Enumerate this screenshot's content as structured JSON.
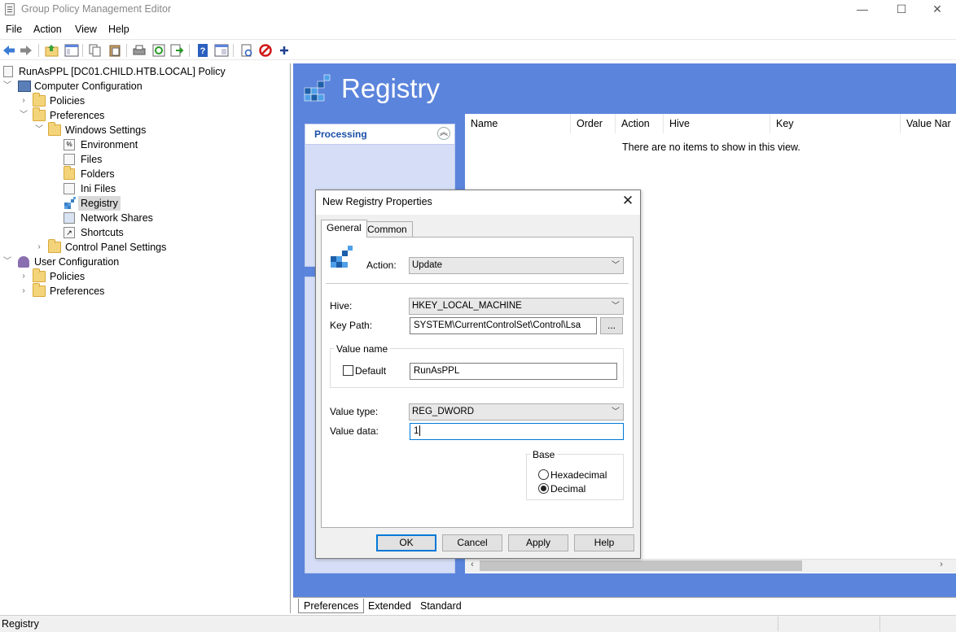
{
  "window": {
    "title": "Group Policy Management Editor",
    "controls": {
      "minimize": "—",
      "maximize": "☐",
      "close": "✕"
    }
  },
  "menu": [
    "File",
    "Action",
    "View",
    "Help"
  ],
  "toolbar": {
    "icons": [
      "back-icon",
      "forward-icon",
      "up-folder-icon",
      "show-hide-tree-icon",
      "copy-icon",
      "paste-icon",
      "print-icon",
      "refresh-icon",
      "export-icon",
      "help-icon",
      "properties-icon",
      "new-item-icon",
      "stop-icon",
      "add-icon"
    ]
  },
  "tree": {
    "root": "RunAsPPL [DC01.CHILD.HTB.LOCAL] Policy",
    "computer_config": "Computer Configuration",
    "policies": "Policies",
    "preferences": "Preferences",
    "windows_settings": "Windows Settings",
    "environment": "Environment",
    "files": "Files",
    "folders": "Folders",
    "ini_files": "Ini Files",
    "registry": "Registry",
    "network_shares": "Network Shares",
    "shortcuts": "Shortcuts",
    "control_panel": "Control Panel Settings",
    "user_config": "User Configuration",
    "user_policies": "Policies",
    "user_preferences": "Preferences"
  },
  "main": {
    "header": "Registry",
    "processing": "Processing",
    "columns": [
      "Name",
      "Order",
      "Action",
      "Hive",
      "Key",
      "Value Nar"
    ],
    "empty_message": "There are no items to show in this view."
  },
  "bottom_tabs": [
    "Preferences",
    "Extended",
    "Standard"
  ],
  "status": {
    "text": "Registry"
  },
  "dialog": {
    "title": "New Registry Properties",
    "close": "✕",
    "tabs": [
      "General",
      "Common"
    ],
    "action_label": "Action:",
    "action_value": "Update",
    "hive_label": "Hive:",
    "hive_value": "HKEY_LOCAL_MACHINE",
    "key_path_label": "Key Path:",
    "key_path_value": "SYSTEM\\CurrentControlSet\\Control\\Lsa",
    "browse": "...",
    "value_name_group": "Value name",
    "default_label": "Default",
    "default_checked": false,
    "value_name": "RunAsPPL",
    "value_type_label": "Value type:",
    "value_type": "REG_DWORD",
    "value_data_label": "Value data:",
    "value_data": "1",
    "base_group": "Base",
    "hex_label": "Hexadecimal",
    "dec_label": "Decimal",
    "base_selected": "Decimal",
    "buttons": {
      "ok": "OK",
      "cancel": "Cancel",
      "apply": "Apply",
      "help": "Help"
    }
  },
  "colors": {
    "accent_blue": "#5b84dc",
    "panel_blue": "#d5def6",
    "processing_text": "#1a4fa8",
    "focus_border": "#0078d7"
  }
}
